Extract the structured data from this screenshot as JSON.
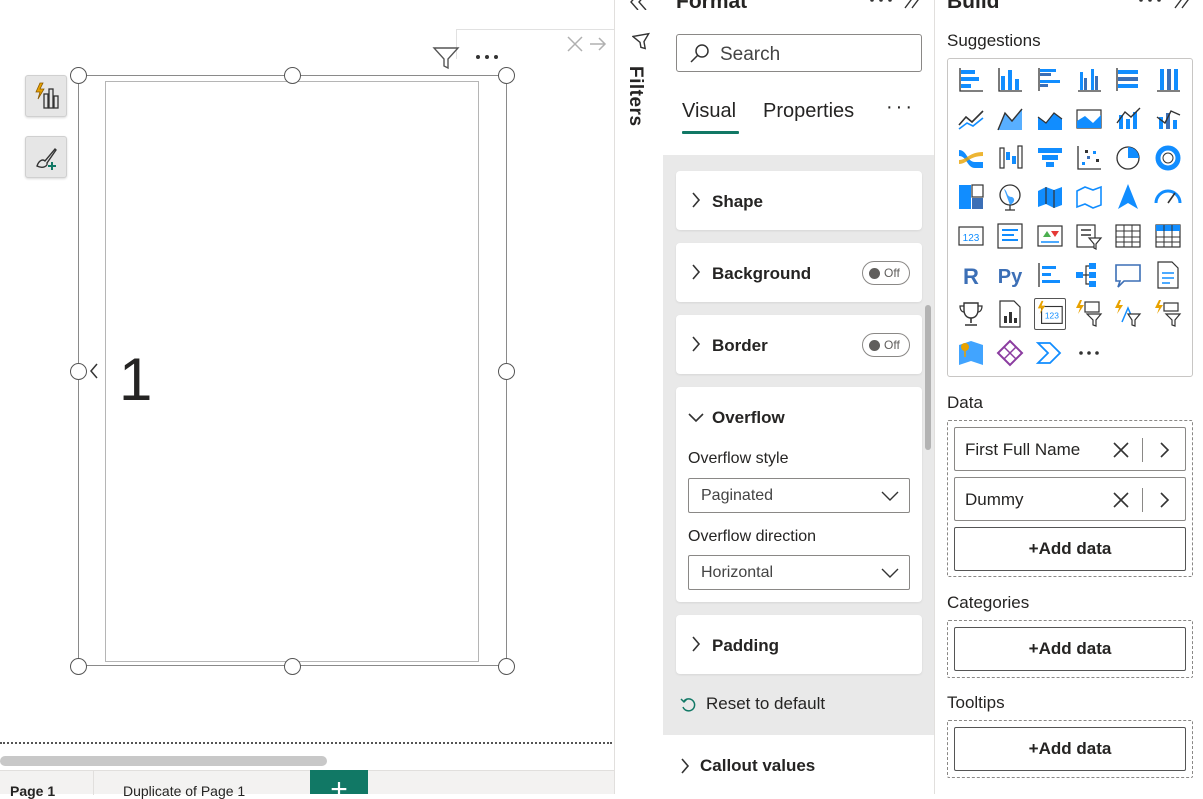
{
  "canvas": {
    "card_value": "1",
    "page_tabs": [
      "Page 1",
      "Duplicate of Page 1"
    ],
    "add_page_label": "+"
  },
  "filters": {
    "label": "Filters"
  },
  "format": {
    "title": "Format",
    "search_placeholder": "Search",
    "tabs": [
      {
        "label": "Visual",
        "active": true
      },
      {
        "label": "Properties",
        "active": false
      }
    ],
    "more_label": "···",
    "cards": {
      "shape": {
        "title": "Shape"
      },
      "background": {
        "title": "Background",
        "toggle": "Off"
      },
      "border": {
        "title": "Border",
        "toggle": "Off"
      },
      "overflow": {
        "title": "Overflow",
        "style_label": "Overflow style",
        "style_value": "Paginated",
        "direction_label": "Overflow direction",
        "direction_value": "Horizontal"
      },
      "padding": {
        "title": "Padding"
      }
    },
    "reset_label": "Reset to default",
    "callout_label": "Callout values"
  },
  "build": {
    "title": "Build",
    "suggestions_label": "Suggestions",
    "data_label": "Data",
    "fields": [
      "First Full Name",
      "Dummy"
    ],
    "add_data_label": "+Add data",
    "categories_label": "Categories",
    "tooltips_label": "Tooltips",
    "more_visuals": "···"
  },
  "colors": {
    "accent": "#117865",
    "viz_blue": "#118dff",
    "viz_dark": "#3c6fb6",
    "ai_orange": "#e8a200"
  }
}
